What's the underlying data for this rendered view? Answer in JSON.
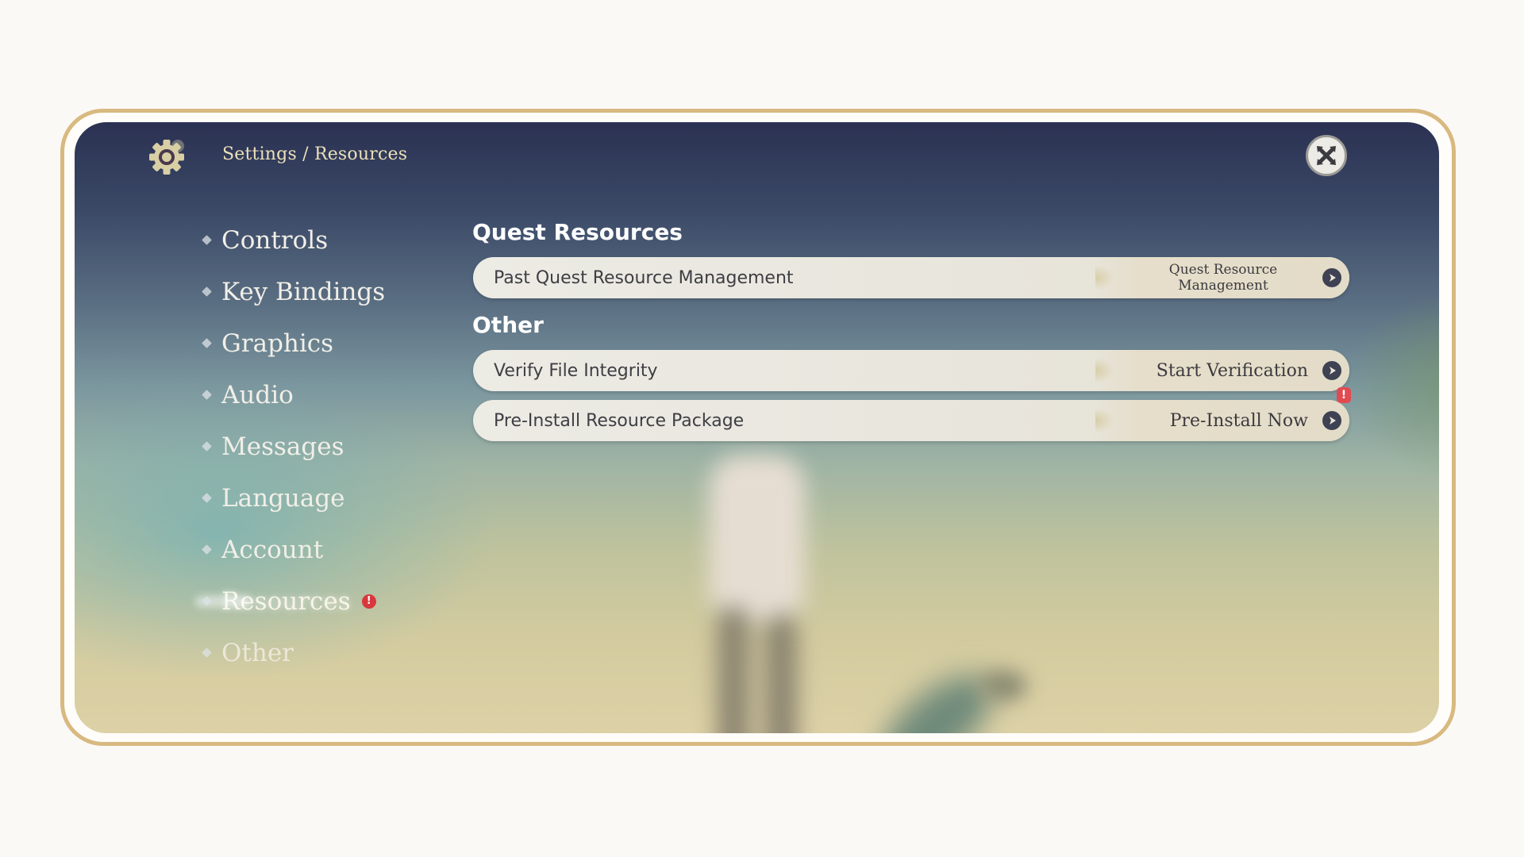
{
  "header": {
    "breadcrumb_root": "Settings",
    "breadcrumb_separator": " / ",
    "breadcrumb_current": "Resources",
    "icon": "gear-icon",
    "close_icon": "close-icon"
  },
  "sidebar": {
    "items": [
      {
        "label": "Controls",
        "active": false
      },
      {
        "label": "Key Bindings",
        "active": false
      },
      {
        "label": "Graphics",
        "active": false
      },
      {
        "label": "Audio",
        "active": false
      },
      {
        "label": "Messages",
        "active": false
      },
      {
        "label": "Language",
        "active": false
      },
      {
        "label": "Account",
        "active": false
      },
      {
        "label": "Resources",
        "active": true,
        "badge": "!"
      },
      {
        "label": "Other",
        "active": false
      }
    ]
  },
  "main": {
    "sections": [
      {
        "heading": "Quest Resources",
        "rows": [
          {
            "label": "Past Quest Resource Management",
            "action": "Quest Resource Management",
            "icon": "arrow-right-icon"
          }
        ]
      },
      {
        "heading": "Other",
        "rows": [
          {
            "label": "Verify File Integrity",
            "action": "Start Verification",
            "icon": "arrow-right-icon"
          },
          {
            "label": "Pre-Install Resource Package",
            "action": "Pre-Install Now",
            "icon": "arrow-right-icon",
            "badge": "!"
          }
        ]
      }
    ]
  },
  "colors": {
    "frame_gold": "#d8b980",
    "breadcrumb_text": "#ebe0b8",
    "alert_red": "#d8383d",
    "row_bg": "#ecebe4",
    "action_icon_bg": "#3e4253"
  }
}
